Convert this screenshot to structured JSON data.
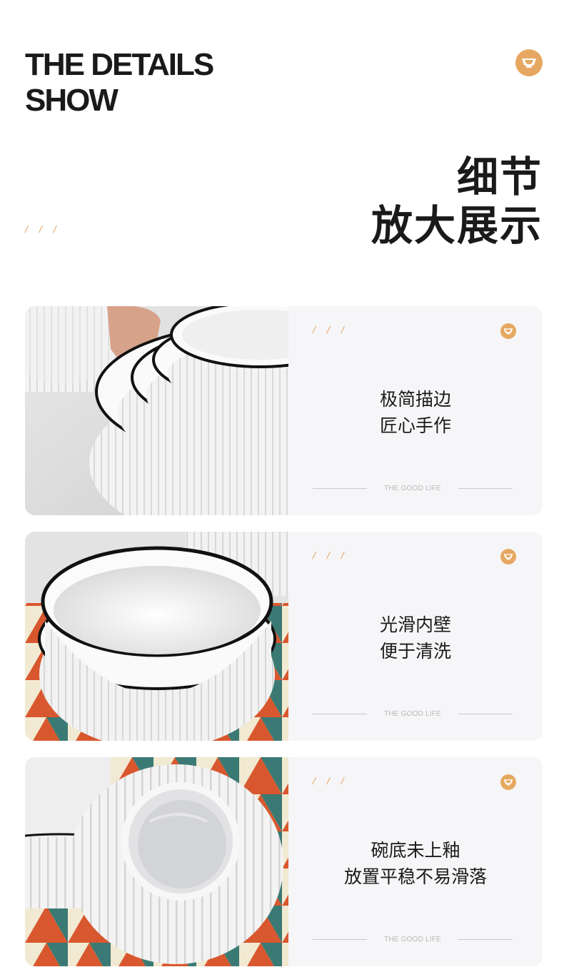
{
  "header": {
    "title_line1": "THE DETAILS",
    "title_line2": "SHOW",
    "logo_icon": "bowl-logo-icon",
    "slashes": "/ / /",
    "cn_line1": "细节",
    "cn_line2": "放大展示"
  },
  "colors": {
    "accent": "#e6a861",
    "card_bg": "#f6f6f8",
    "text": "#1a1a1a"
  },
  "cards": [
    {
      "slashes": "/ / /",
      "line1": "极简描边",
      "line2": "匠心手作",
      "tagline": "THE GOOD LIFE",
      "photo": "stacked-ribbed-bowls-photo"
    },
    {
      "slashes": "/ / /",
      "line1": "光滑内壁",
      "line2": "便于清洗",
      "tagline": "THE GOOD LIFE",
      "photo": "bowl-interior-photo"
    },
    {
      "slashes": "/ / /",
      "line1": "碗底未上釉",
      "line2": "放置平稳不易滑落",
      "tagline": "THE GOOD LIFE",
      "photo": "bowl-bottom-photo"
    }
  ]
}
